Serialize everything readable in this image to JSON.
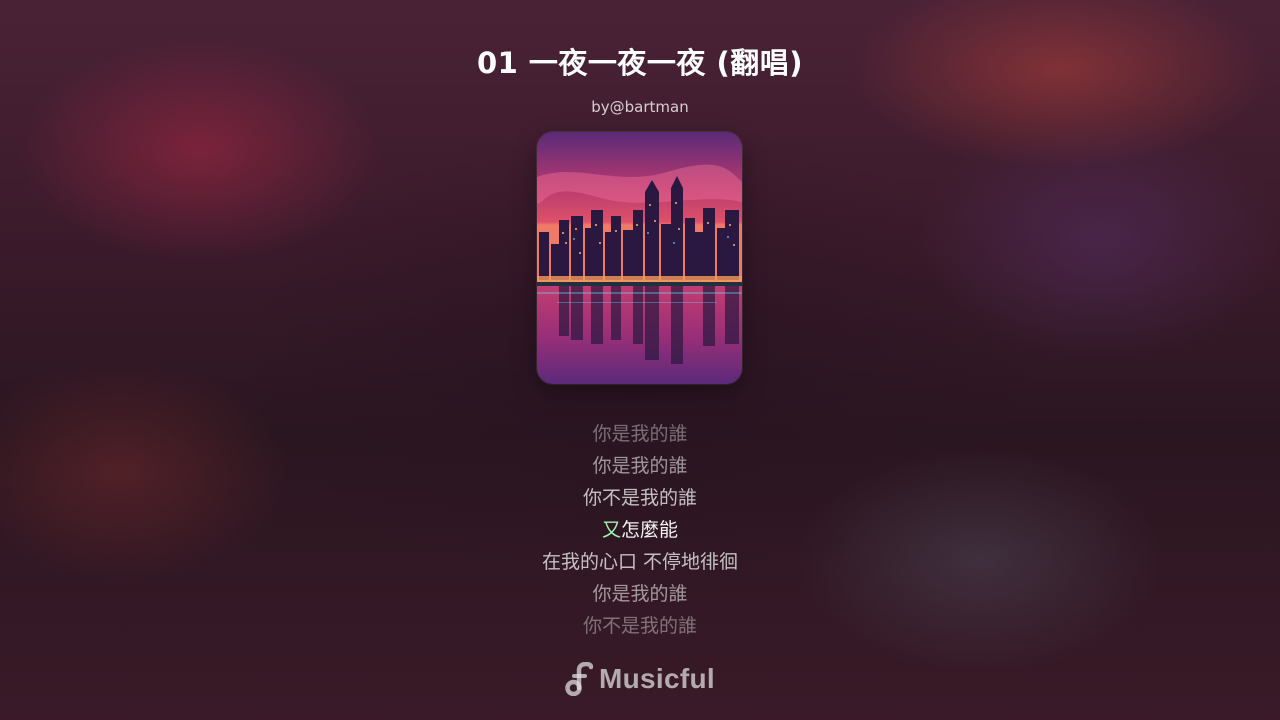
{
  "song": {
    "title": "01 一夜一夜一夜 (翻唱)",
    "artist": "by@bartman",
    "cover_image": "city-skyline-sunset-reflection"
  },
  "lyrics": {
    "lines": [
      {
        "text": "你是我的誰"
      },
      {
        "text": "你是我的誰"
      },
      {
        "text": "你不是我的誰"
      },
      {
        "sung": "又",
        "unsung": "怎麼能"
      },
      {
        "text": "在我的心口 不停地徘徊"
      },
      {
        "text": "你是我的誰"
      },
      {
        "text": "你不是我的誰"
      }
    ]
  },
  "brand": {
    "name": "Musicful",
    "icon": "music-note-icon"
  },
  "colors": {
    "current_sung": "#9ef3b0",
    "current_line": "#f2f2f2"
  }
}
